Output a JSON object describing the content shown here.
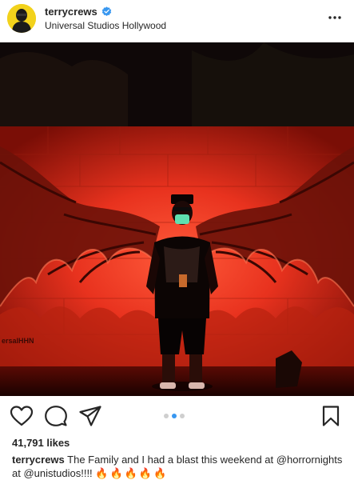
{
  "post": {
    "username": "terrycrews",
    "location": "Universal Studios Hollywood",
    "likes": "41,791 likes",
    "caption": {
      "username": "terrycrews",
      "text_1": "The Family and I had a blast this weekend at",
      "mention_1": "@horrornights",
      "text_2": "at",
      "mention_2": "@unistudios",
      "text_3": "!!!!",
      "emoji": "🔥🔥🔥🔥🔥"
    },
    "photo": {
      "watermark": "ersalHHN"
    },
    "carousel": {
      "total": 3,
      "active": 2
    }
  },
  "icons": {
    "verified": "verified-badge-icon",
    "more": "more-options-icon",
    "like": "heart-icon",
    "comment": "comment-icon",
    "share": "share-icon",
    "save": "bookmark-icon"
  },
  "colors": {
    "verified": "#3897f0",
    "carousel_active": "#3897f0",
    "carousel_inactive": "#cfcfcf",
    "avatar_bg": "#f2d21c",
    "photo_glow": "#e8321e"
  }
}
